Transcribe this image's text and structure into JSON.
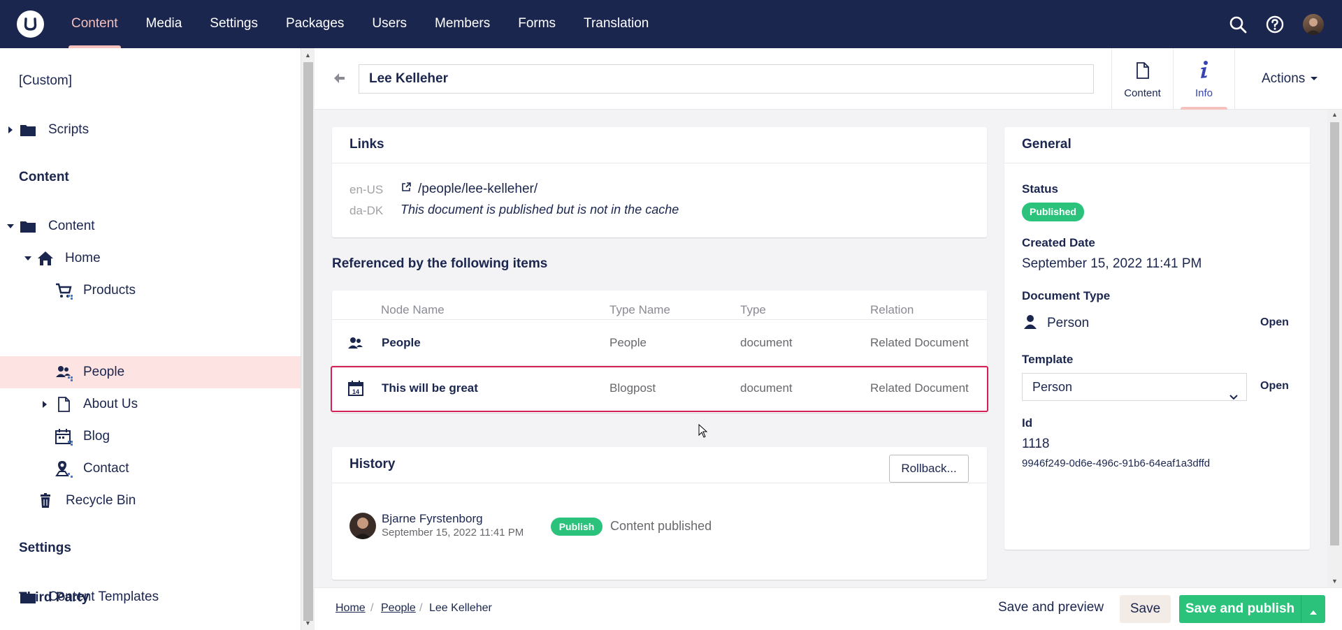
{
  "topnav": {
    "items": [
      "Content",
      "Media",
      "Settings",
      "Packages",
      "Users",
      "Members",
      "Forms",
      "Translation"
    ],
    "active_index": 0,
    "icons": [
      "search-icon",
      "help-icon",
      "user-avatar"
    ]
  },
  "sidebar": {
    "sections": {
      "custom": "[Custom]",
      "content": "Content",
      "settings": "Settings",
      "third_party": "Third Party"
    },
    "items": {
      "scripts": "Scripts",
      "content_root": "Content",
      "home": "Home",
      "products": "Products",
      "people": "People",
      "about_us": "About Us",
      "blog": "Blog",
      "contact": "Contact",
      "recycle_bin": "Recycle Bin",
      "content_templates": "Content Templates"
    },
    "selected": "people"
  },
  "header": {
    "name_value": "Lee Kelleher",
    "tabs": {
      "content": "Content",
      "info": "Info"
    },
    "active_tab": "info",
    "actions": "Actions"
  },
  "links": {
    "title": "Links",
    "rows": [
      {
        "culture": "en-US",
        "text": "/people/lee-kelleher/"
      },
      {
        "culture": "da-DK",
        "text": "This document is published but is not in the cache"
      }
    ]
  },
  "references": {
    "title": "Referenced by the following items",
    "columns": {
      "node": "Node Name",
      "type_name": "Type Name",
      "type": "Type",
      "relation": "Relation"
    },
    "rows": [
      {
        "node": "People",
        "type_name": "People",
        "type": "document",
        "relation": "Related Document",
        "icon": "people-icon"
      },
      {
        "node": "This will be great",
        "type_name": "Blogpost",
        "type": "document",
        "relation": "Related Document",
        "icon": "calendar-icon"
      }
    ]
  },
  "history": {
    "title": "History",
    "rollback": "Rollback...",
    "entries": [
      {
        "user": "Bjarne Fyrstenborg",
        "date": "September 15, 2022 11:41 PM",
        "badge": "Publish",
        "message": "Content published"
      }
    ]
  },
  "general": {
    "title": "General",
    "status_label": "Status",
    "status": "Published",
    "created_label": "Created Date",
    "created": "September 15, 2022 11:41 PM",
    "doctype_label": "Document Type",
    "doctype": "Person",
    "open": "Open",
    "template_label": "Template",
    "template": "Person",
    "id_label": "Id",
    "id": "1118",
    "guid": "9946f249-0d6e-496c-91b6-64eaf1a3dffd"
  },
  "footer": {
    "breadcrumb": [
      "Home",
      "People",
      "Lee Kelleher"
    ],
    "save_preview": "Save and preview",
    "save": "Save",
    "save_publish": "Save and publish"
  },
  "colors": {
    "nav_bg": "#1b264f",
    "accent_pink": "#f5c1bc",
    "selected_bg": "#fde4e2",
    "success": "#2bc37c",
    "highlight_border": "#d42054"
  }
}
